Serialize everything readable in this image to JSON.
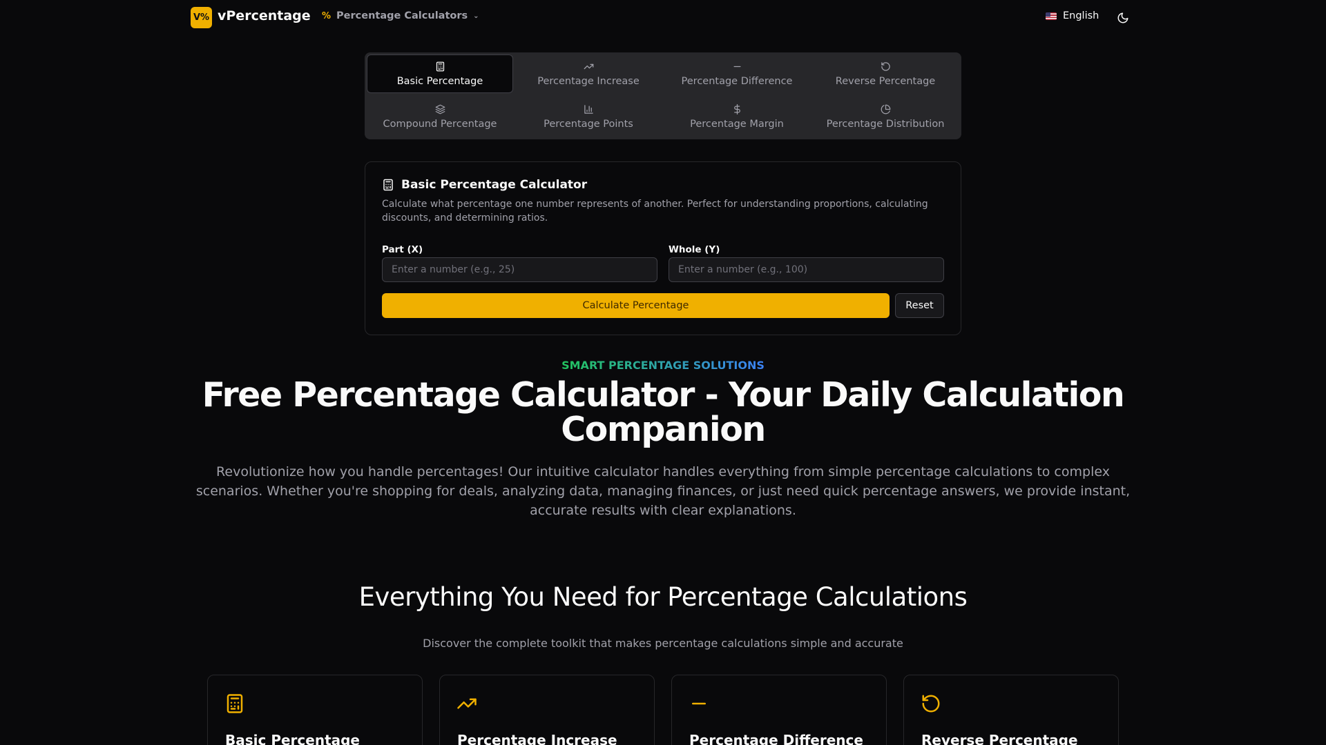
{
  "header": {
    "logo_text": "V%",
    "brand": "vPercentage",
    "nav_label": "Percentage Calculators",
    "language": "English"
  },
  "tabs": [
    {
      "label": "Basic Percentage",
      "icon": "calculator-icon",
      "active": true
    },
    {
      "label": "Percentage Increase",
      "icon": "trending-up-icon",
      "active": false
    },
    {
      "label": "Percentage Difference",
      "icon": "minus-icon",
      "active": false
    },
    {
      "label": "Reverse Percentage",
      "icon": "rotate-ccw-icon",
      "active": false
    },
    {
      "label": "Compound Percentage",
      "icon": "layers-icon",
      "active": false
    },
    {
      "label": "Percentage Points",
      "icon": "bar-chart-icon",
      "active": false
    },
    {
      "label": "Percentage Margin",
      "icon": "dollar-icon",
      "active": false
    },
    {
      "label": "Percentage Distribution",
      "icon": "pie-chart-icon",
      "active": false
    }
  ],
  "calculator": {
    "title": "Basic Percentage Calculator",
    "description": "Calculate what percentage one number represents of another. Perfect for understanding proportions, calculating discounts, and determining ratios.",
    "part_label": "Part (X)",
    "part_placeholder": "Enter a number (e.g., 25)",
    "whole_label": "Whole (Y)",
    "whole_placeholder": "Enter a number (e.g., 100)",
    "calc_button": "Calculate Percentage",
    "reset_button": "Reset"
  },
  "hero": {
    "eyebrow": "SMART PERCENTAGE SOLUTIONS",
    "title": "Free Percentage Calculator - Your Daily Calculation Companion",
    "description": "Revolutionize how you handle percentages! Our intuitive calculator handles everything from simple percentage calculations to complex scenarios. Whether you're shopping for deals, analyzing data, managing finances, or just need quick percentage answers, we provide instant, accurate results with clear explanations."
  },
  "features": {
    "title": "Everything You Need for Percentage Calculations",
    "subtitle": "Discover the complete toolkit that makes percentage calculations simple and accurate",
    "cards": [
      {
        "name": "Basic Percentage",
        "icon": "calculator-icon"
      },
      {
        "name": "Percentage Increase",
        "icon": "trending-up-icon"
      },
      {
        "name": "Percentage Difference",
        "icon": "minus-icon"
      },
      {
        "name": "Reverse Percentage",
        "icon": "rotate-ccw-icon"
      }
    ]
  },
  "colors": {
    "accent": "#f0b000",
    "background": "#09090b",
    "panel": "#27272a",
    "muted_text": "#a1a1aa"
  }
}
